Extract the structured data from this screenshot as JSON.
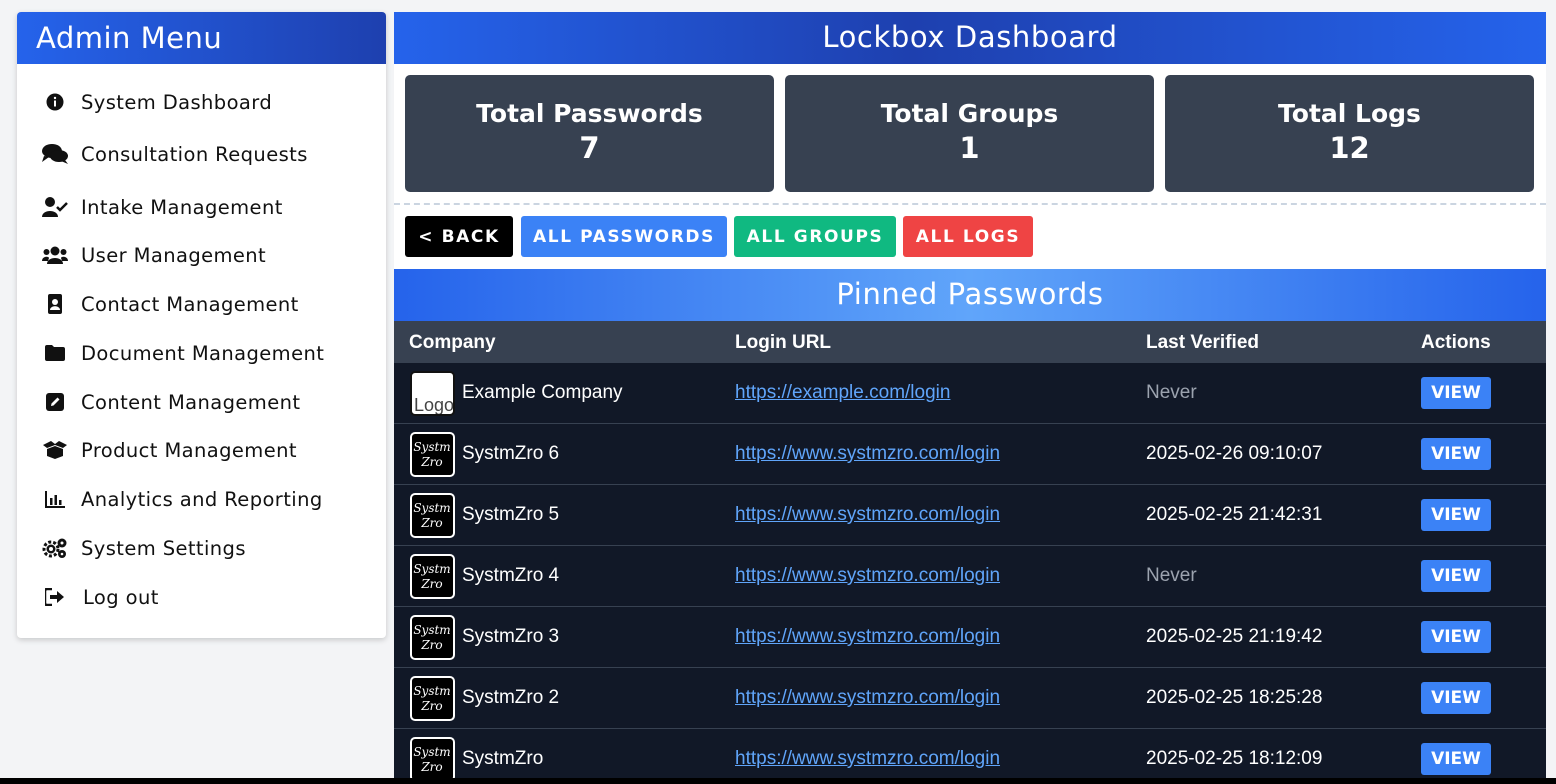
{
  "sidebar": {
    "title": "Admin Menu",
    "items": [
      {
        "label": "System Dashboard",
        "icon": "info-circle-icon"
      },
      {
        "label": "Consultation Requests",
        "icon": "comments-icon"
      },
      {
        "label": "Intake Management",
        "icon": "user-check-icon"
      },
      {
        "label": "User Management",
        "icon": "users-icon"
      },
      {
        "label": "Contact Management",
        "icon": "address-book-icon"
      },
      {
        "label": "Document Management",
        "icon": "folder-icon"
      },
      {
        "label": "Content Management",
        "icon": "edit-icon"
      },
      {
        "label": "Product Management",
        "icon": "box-open-icon"
      },
      {
        "label": "Analytics and Reporting",
        "icon": "chart-bar-icon"
      },
      {
        "label": "System Settings",
        "icon": "cogs-icon"
      },
      {
        "label": "Log out",
        "icon": "sign-out-icon"
      }
    ]
  },
  "main": {
    "title": "Lockbox Dashboard",
    "stats": [
      {
        "label": "Total Passwords",
        "value": "7"
      },
      {
        "label": "Total Groups",
        "value": "1"
      },
      {
        "label": "Total Logs",
        "value": "12"
      }
    ],
    "buttons": {
      "back": "< BACK",
      "all_passwords": "ALL PASSWORDS",
      "all_groups": "ALL GROUPS",
      "all_logs": "ALL LOGS"
    },
    "pinned_title": "Pinned Passwords",
    "table": {
      "headers": [
        "Company",
        "Login URL",
        "Last Verified",
        "Actions"
      ],
      "logo_alt": "Logo",
      "logo_text_1": "Systm",
      "logo_text_2": "Zro",
      "view_label": "VIEW",
      "rows": [
        {
          "company": "Example Company",
          "url": "https://example.com/login",
          "verified": "Never",
          "logo": "broken"
        },
        {
          "company": "SystmZro 6",
          "url": "https://www.systmzro.com/login",
          "verified": "2025-02-26 09:10:07",
          "logo": "systmzro"
        },
        {
          "company": "SystmZro 5",
          "url": "https://www.systmzro.com/login",
          "verified": "2025-02-25 21:42:31",
          "logo": "systmzro"
        },
        {
          "company": "SystmZro 4",
          "url": "https://www.systmzro.com/login",
          "verified": "Never",
          "logo": "systmzro"
        },
        {
          "company": "SystmZro 3",
          "url": "https://www.systmzro.com/login",
          "verified": "2025-02-25 21:19:42",
          "logo": "systmzro"
        },
        {
          "company": "SystmZro 2",
          "url": "https://www.systmzro.com/login",
          "verified": "2025-02-25 18:25:28",
          "logo": "systmzro"
        },
        {
          "company": "SystmZro",
          "url": "https://www.systmzro.com/login",
          "verified": "2025-02-25 18:12:09",
          "logo": "systmzro"
        }
      ]
    }
  }
}
